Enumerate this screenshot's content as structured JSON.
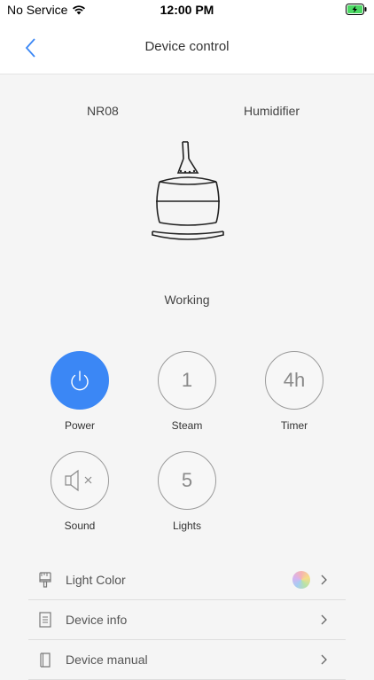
{
  "status_bar": {
    "carrier": "No Service",
    "time": "12:00 PM"
  },
  "nav": {
    "title": "Device control"
  },
  "device": {
    "model": "NR08",
    "type": "Humidifier",
    "status": "Working"
  },
  "controls": [
    {
      "label": "Power",
      "value": "",
      "active": true
    },
    {
      "label": "Steam",
      "value": "1",
      "active": false
    },
    {
      "label": "Timer",
      "value": "4h",
      "active": false
    },
    {
      "label": "Sound",
      "value": "",
      "active": false
    },
    {
      "label": "Lights",
      "value": "5",
      "active": false
    }
  ],
  "menu": [
    {
      "label": "Light Color"
    },
    {
      "label": "Device info"
    },
    {
      "label": "Device manual"
    }
  ],
  "colors": {
    "accent": "#3b87f5",
    "battery": "#4cd964"
  }
}
